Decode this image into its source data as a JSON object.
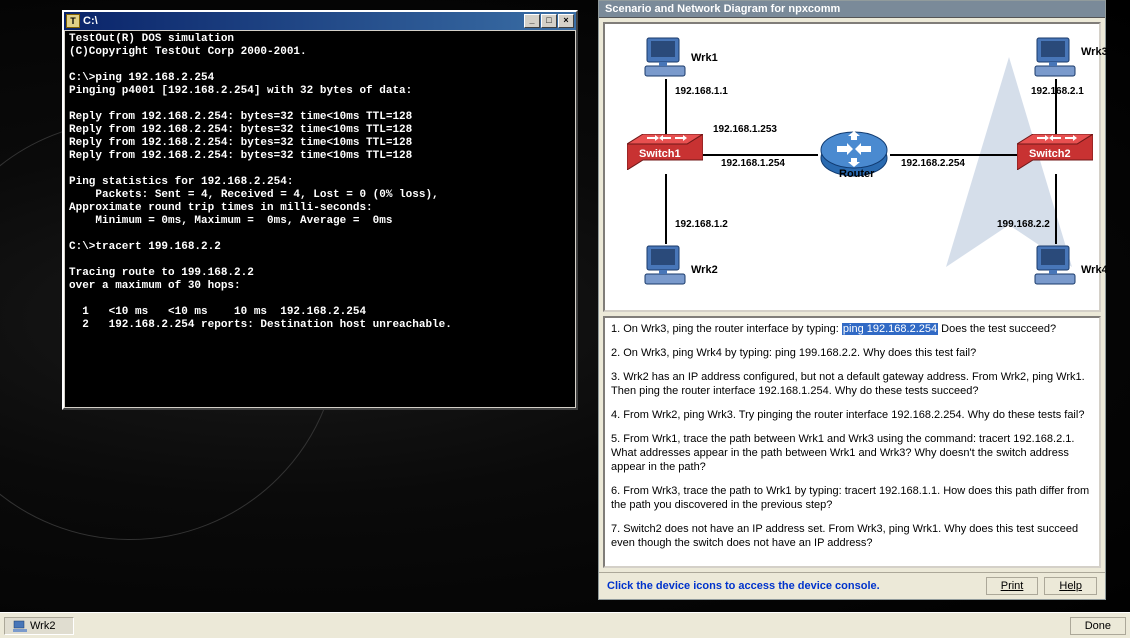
{
  "terminal": {
    "title": "C:\\",
    "lines": [
      "TestOut(R) DOS simulation",
      "(C)Copyright TestOut Corp 2000-2001.",
      "",
      "C:\\>ping 192.168.2.254",
      "Pinging p4001 [192.168.2.254] with 32 bytes of data:",
      "",
      "Reply from 192.168.2.254: bytes=32 time<10ms TTL=128",
      "Reply from 192.168.2.254: bytes=32 time<10ms TTL=128",
      "Reply from 192.168.2.254: bytes=32 time<10ms TTL=128",
      "Reply from 192.168.2.254: bytes=32 time<10ms TTL=128",
      "",
      "Ping statistics for 192.168.2.254:",
      "    Packets: Sent = 4, Received = 4, Lost = 0 (0% loss),",
      "Approximate round trip times in milli-seconds:",
      "    Minimum = 0ms, Maximum =  0ms, Average =  0ms",
      "",
      "C:\\>tracert 199.168.2.2",
      "",
      "Tracing route to 199.168.2.2",
      "over a maximum of 30 hops:",
      "",
      "  1   <10 ms   <10 ms    10 ms  192.168.2.254",
      "  2   192.168.2.254 reports: Destination host unreachable."
    ]
  },
  "scenario": {
    "title": "Scenario and Network Diagram for npxcomm",
    "footer_text": "Click the device icons to access the device console.",
    "print_label": "Print",
    "help_label": "Help"
  },
  "diagram": {
    "devices": {
      "wrk1": {
        "label": "Wrk1",
        "ip": "192.168.1.1"
      },
      "wrk2": {
        "label": "Wrk2",
        "ip": "192.168.1.2"
      },
      "wrk3": {
        "label": "Wrk3",
        "ip": "192.168.2.1"
      },
      "wrk4": {
        "label": "Wrk4",
        "ip": "199.168.2.2"
      },
      "switch1": {
        "label": "Switch1",
        "ip_up": "192.168.1.253"
      },
      "switch2": {
        "label": "Switch2"
      },
      "router": {
        "label": "Router",
        "ip_left": "192.168.1.254",
        "ip_right": "192.168.2.254"
      }
    }
  },
  "questions": {
    "q1a": "1. On Wrk3, ping the router interface by typing: ",
    "q1_hl": "ping 192.168.2.254",
    "q1b": " Does the test succeed?",
    "q2": "2. On Wrk3, ping Wrk4 by typing: ping 199.168.2.2. Why does this test fail?",
    "q3": "3. Wrk2 has an IP address configured, but not a default gateway address. From Wrk2, ping Wrk1. Then ping the router interface 192.168.1.254. Why do these tests succeed?",
    "q4": "4. From Wrk2, ping Wrk3. Try pinging the router interface 192.168.2.254. Why do these tests fail?",
    "q5": "5. From Wrk1, trace the path between Wrk1 and Wrk3 using the command: tracert 192.168.2.1. What addresses appear in the path between Wrk1 and Wrk3? Why doesn't the switch address appear in the path?",
    "q6": "6. From Wrk3, trace the path to Wrk1 by typing: tracert 192.168.1.1. How does this path differ from the path you discovered in the previous step?",
    "q7": "7. Switch2 does not have an IP address set. From Wrk3, ping Wrk1. Why does this test succeed even though the switch does not have an IP address?"
  },
  "taskbar": {
    "item": "Wrk2",
    "done": "Done"
  }
}
